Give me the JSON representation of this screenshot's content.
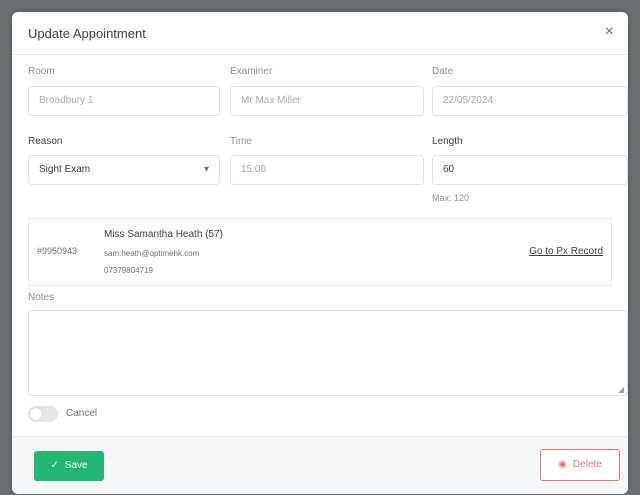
{
  "modal": {
    "title": "Update Appointment",
    "close": "×"
  },
  "fields": {
    "room": {
      "label": "Room",
      "value": "Broadbury 1"
    },
    "examiner": {
      "label": "Examiner",
      "value": "Mr Max Miller"
    },
    "date": {
      "label": "Date",
      "value": "22/05/2024"
    },
    "reason": {
      "label": "Reason",
      "value": "Sight Exam"
    },
    "time": {
      "label": "Time",
      "value": "15:00"
    },
    "length": {
      "label": "Length",
      "value": "60",
      "hint": "Max: 120"
    }
  },
  "patient": {
    "id": "#9950943",
    "name": "Miss Samantha Heath (57)",
    "email": "sam.heath@optimehk.com",
    "phone": "07379804719",
    "link": "Go to Px Record"
  },
  "notes": {
    "label": "Notes",
    "value": ""
  },
  "cancel": {
    "label": "Cancel",
    "checked": false
  },
  "buttons": {
    "save": "Save",
    "delete": "Delete"
  },
  "colors": {
    "accent": "#22b573",
    "danger": "#e57373"
  }
}
